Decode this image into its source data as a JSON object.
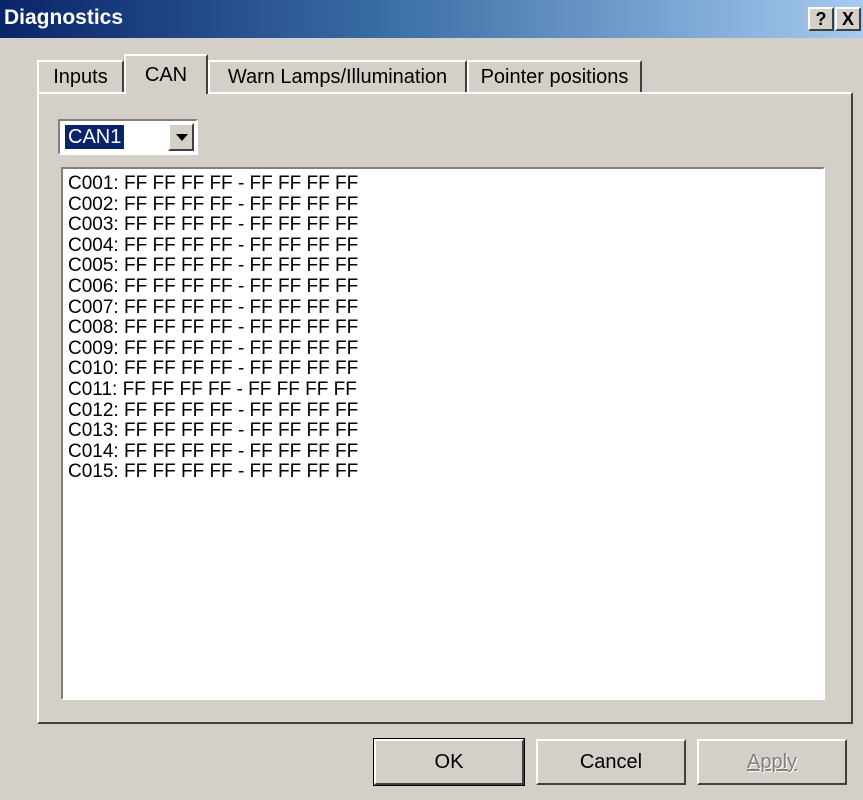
{
  "window": {
    "title": "Diagnostics",
    "help_label": "?",
    "close_label": "X"
  },
  "tabs": [
    {
      "label": "Inputs",
      "active": false
    },
    {
      "label": "CAN",
      "active": true
    },
    {
      "label": "Warn Lamps/Illumination",
      "active": false
    },
    {
      "label": "Pointer positions",
      "active": false
    }
  ],
  "can_selector": {
    "selected": "CAN1"
  },
  "list": {
    "lines": [
      "C001: FF FF FF FF - FF FF FF FF",
      "C002: FF FF FF FF - FF FF FF FF",
      "C003: FF FF FF FF - FF FF FF FF",
      "C004: FF FF FF FF - FF FF FF FF",
      "C005: FF FF FF FF - FF FF FF FF",
      "C006: FF FF FF FF - FF FF FF FF",
      "C007: FF FF FF FF - FF FF FF FF",
      "C008: FF FF FF FF - FF FF FF FF",
      "C009: FF FF FF FF - FF FF FF FF",
      "C010: FF FF FF FF - FF FF FF FF",
      "C011: FF FF FF FF - FF FF FF FF",
      "C012: FF FF FF FF - FF FF FF FF",
      "C013: FF FF FF FF - FF FF FF FF",
      "C014: FF FF FF FF - FF FF FF FF",
      "C015: FF FF FF FF - FF FF FF FF"
    ]
  },
  "buttons": {
    "ok": "OK",
    "cancel": "Cancel",
    "apply": "Apply"
  }
}
